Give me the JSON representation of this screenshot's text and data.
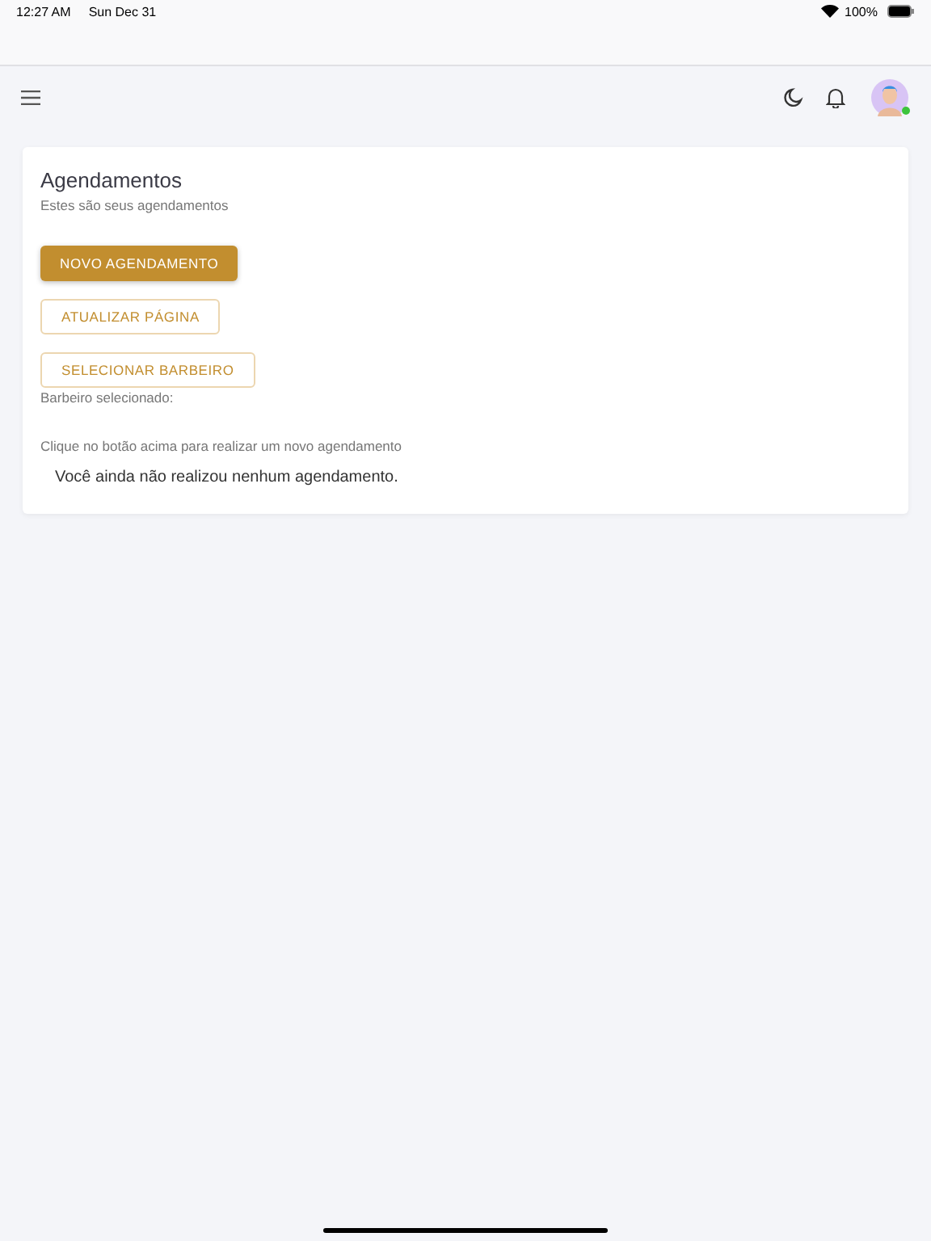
{
  "status_bar": {
    "time": "12:27 AM",
    "date": "Sun Dec 31",
    "battery": "100%"
  },
  "card": {
    "title": "Agendamentos",
    "subtitle": "Estes são seus agendamentos",
    "buttons": [
      {
        "label": "NOVO AGENDAMENTO",
        "kind": "primary"
      },
      {
        "label": "ATUALIZAR PÁGINA",
        "kind": "outline"
      },
      {
        "label": "SELECIONAR BARBEIRO",
        "kind": "outline"
      }
    ],
    "selected_barber_label": "Barbeiro selecionado:",
    "hint": "Clique no botão acima para realizar um novo agendamento",
    "empty_message": "Você ainda não realizou nenhum agendamento."
  },
  "user": {
    "online": true
  }
}
